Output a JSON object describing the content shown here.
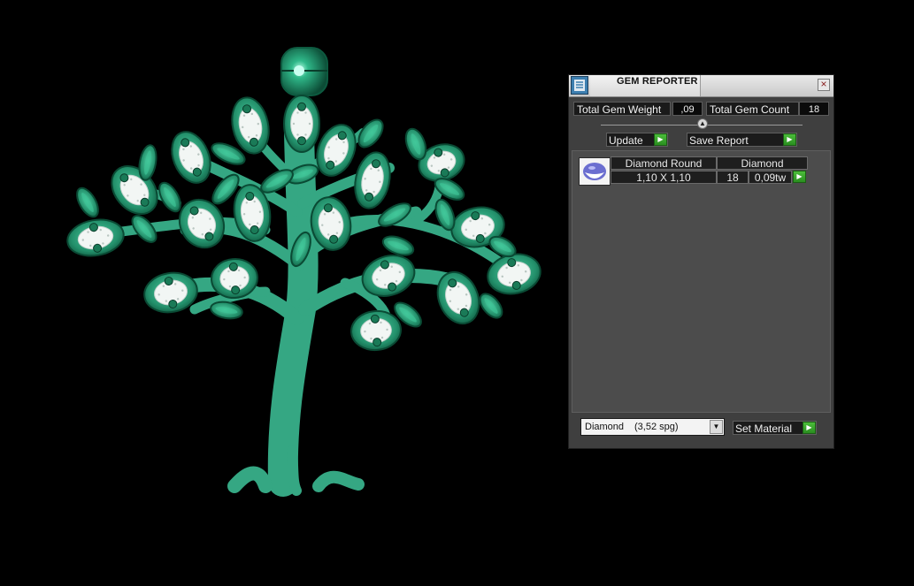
{
  "viewport": {
    "model": "tree-of-life-pendant",
    "metal_color": "#35a783",
    "background": "#000000"
  },
  "gem_reporter": {
    "title": "GEM REPORTER",
    "close_glyph": "×",
    "total_gem_weight_label": "Total Gem Weight",
    "total_gem_weight_value": ",09",
    "total_gem_count_label": "Total Gem Count",
    "total_gem_count_value": "18",
    "update_label": "Update",
    "save_report_label": "Save Report",
    "slider_glyph": "▲",
    "arrow_glyph": "▶",
    "table": {
      "header_shape": "Diamond Round",
      "header_material": "Diamond",
      "size": "1,10 X 1,10",
      "count": "18",
      "weight": "0,09tw"
    },
    "material_select": {
      "name": "Diamond",
      "density": "(3,52 spg)",
      "arrow_glyph": "▼"
    },
    "set_material_label": "Set Material"
  }
}
